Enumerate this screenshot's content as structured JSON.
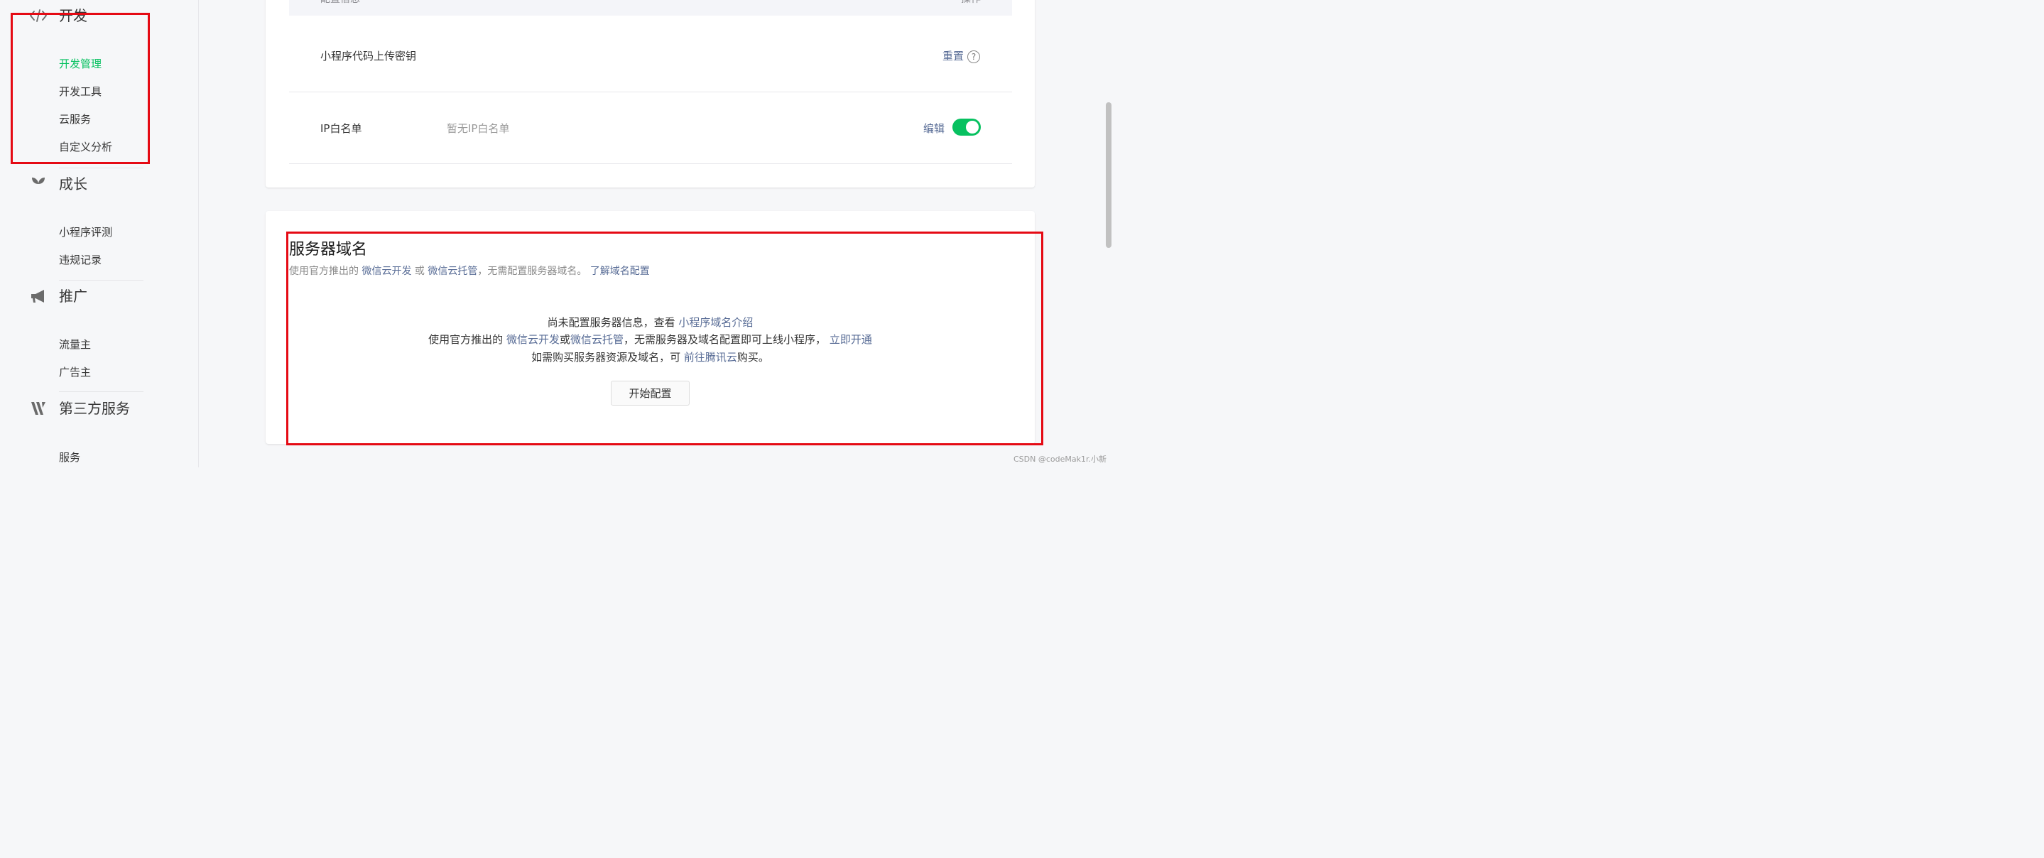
{
  "sidebar": {
    "groups": [
      {
        "title": "开发",
        "icon": "code-icon",
        "items": [
          "开发管理",
          "开发工具",
          "云服务",
          "自定义分析"
        ],
        "active_item": "开发管理"
      },
      {
        "title": "成长",
        "icon": "sprout-icon",
        "items": [
          "小程序评测",
          "违规记录"
        ]
      },
      {
        "title": "推广",
        "icon": "megaphone-icon",
        "items": [
          "流量主",
          "广告主"
        ]
      },
      {
        "title": "第三方服务",
        "icon": "third-party-icon",
        "items": [
          "服务"
        ]
      }
    ]
  },
  "dev_settings": {
    "table_header": {
      "col_info": "配置信息",
      "col_action": "操作"
    },
    "rows": [
      {
        "label": "小程序代码上传密钥",
        "value": "",
        "action": "重置"
      },
      {
        "label": "IP白名单",
        "value": "暂无IP白名单",
        "action": "编辑",
        "toggle_on": true
      }
    ]
  },
  "server_domain": {
    "title": "服务器域名",
    "desc_prefix": "使用官方推出的",
    "desc_link1": "微信云开发",
    "desc_or": "或",
    "desc_link2": "微信云托管",
    "desc_middle": "，无需配置服务器域名。",
    "desc_link3": "了解域名配置",
    "line1_text": "尚未配置服务器信息，查看",
    "line1_link": "小程序域名介绍",
    "line2_prefix": "使用官方推出的",
    "line2_link1": "微信云开发",
    "line2_or": "或",
    "line2_link2": "微信云托管",
    "line2_middle": "，无需服务器及域名配置即可上线小程序，",
    "line2_link3": "立即开通",
    "line3_prefix": "如需购买服务器资源及域名，可",
    "line3_link": "前往腾讯云",
    "line3_suffix": "购买。",
    "button_label": "开始配置"
  },
  "watermark": "CSDN @codeMak1r.小新",
  "colors": {
    "accent_green": "#07c160",
    "link_blue": "#576b95",
    "highlight_red": "#e50a14"
  }
}
